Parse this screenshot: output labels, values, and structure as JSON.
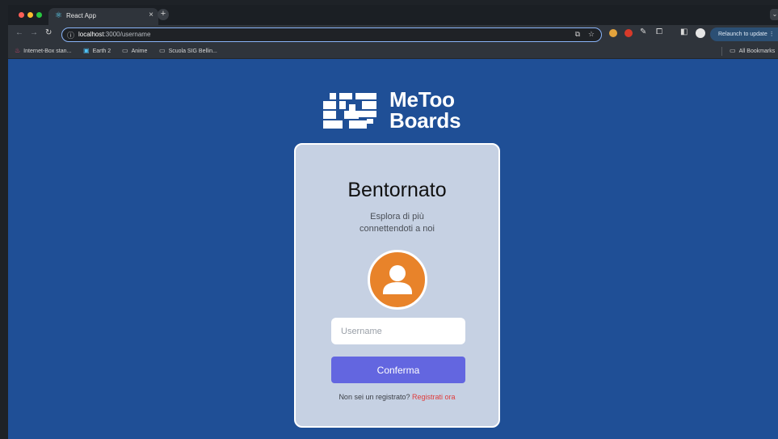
{
  "browser": {
    "tab": {
      "title": "React App"
    },
    "address_bar": {
      "host": "localhost",
      "path": ":3000/username"
    },
    "relaunch_label": "Relaunch to update",
    "bookmarks": [
      {
        "label": "Internet-Box stan...",
        "icon": "flame-icon"
      },
      {
        "label": "Earth 2",
        "icon": "earth-app-icon"
      },
      {
        "label": "Anime",
        "icon": "folder-icon"
      },
      {
        "label": "Scuola SIG Bellin...",
        "icon": "folder-icon"
      }
    ],
    "all_bookmarks_label": "All Bookmarks"
  },
  "brand": {
    "name_line1": "MeToo",
    "name_line2": "Boards",
    "colors": {
      "background": "#1f4f96",
      "card": "#c6d1e3",
      "accent": "#6366e0",
      "avatar": "#e8832a",
      "link": "#e03b3b"
    }
  },
  "login": {
    "title": "Bentornato",
    "subtitle_line1": "Esplora di più",
    "subtitle_line2": "connettendoti a noi",
    "username_placeholder": "Username",
    "username_value": "",
    "confirm_label": "Conferma",
    "register_prompt": "Non sei un registrato?",
    "register_link": "Registrati ora"
  }
}
